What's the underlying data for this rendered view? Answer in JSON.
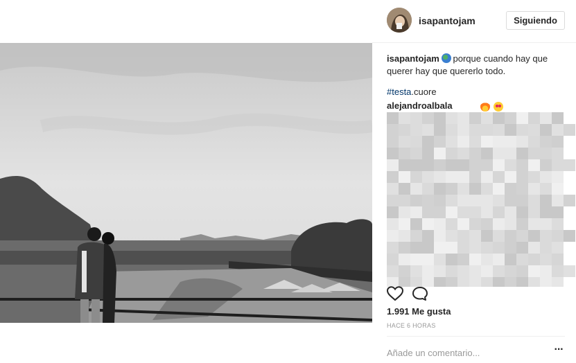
{
  "post": {
    "photo_alt": "black and white photo of a couple over a city park",
    "header": {
      "username": "isapantojam",
      "follow_button": "Siguiendo"
    },
    "caption": {
      "username": "isapantojam",
      "emoji": "globe-emoji",
      "text": "porque cuando hay que querer hay que quererlo todo."
    },
    "hashtag": {
      "tag": "#testa",
      "rest": ".cuore"
    },
    "comment": {
      "username": "alejandroalbala",
      "emojis": [
        "fire-emoji",
        "heart-eyes-emoji"
      ]
    },
    "actions": {
      "like_icon": "heart-outline-icon",
      "comment_icon": "speech-bubble-icon"
    },
    "likes": "1.991 Me gusta",
    "time": "HACE 6 HORAS",
    "add_comment": {
      "placeholder": "Añade un comentario...",
      "more_label": "···"
    }
  }
}
